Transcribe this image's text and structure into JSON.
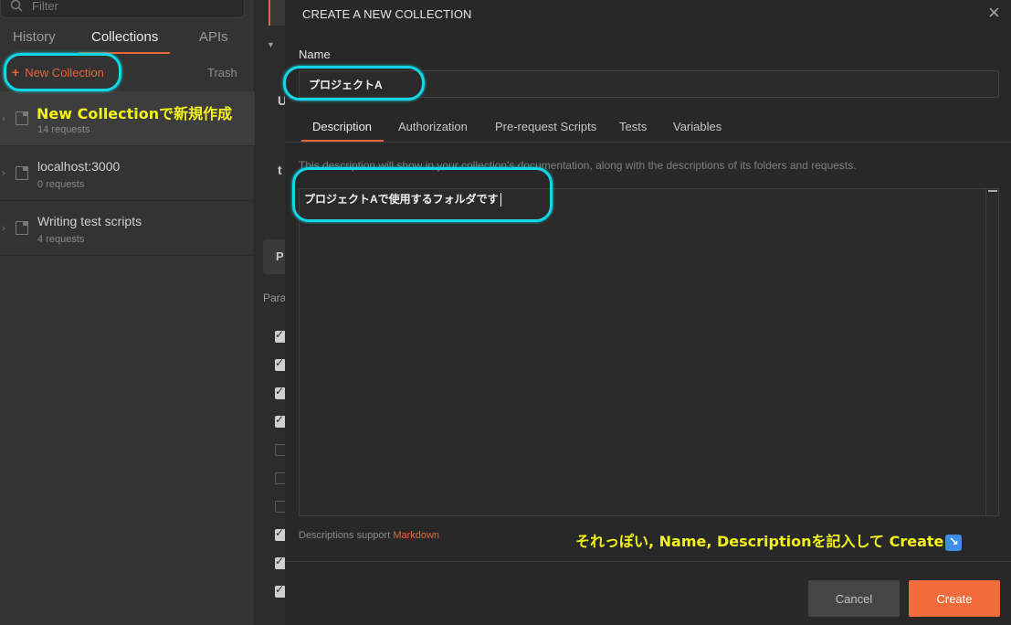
{
  "sidebar": {
    "filter_placeholder": "Filter",
    "tabs": [
      {
        "label": "History"
      },
      {
        "label": "Collections"
      },
      {
        "label": "APIs"
      }
    ],
    "new_collection": "New Collection",
    "trash": "Trash",
    "collections": [
      {
        "name": "",
        "count": "14 requests"
      },
      {
        "name": "localhost:3000",
        "count": "0 requests"
      },
      {
        "name": "Writing test scripts",
        "count": "4 requests"
      }
    ]
  },
  "middle": {
    "letter_u": "U",
    "letter_t": "t",
    "letter_p": "P",
    "para_label": "Para"
  },
  "modal": {
    "title": "CREATE A NEW COLLECTION",
    "close": "×",
    "name_label": "Name",
    "name_value": "プロジェクトA",
    "tabs": [
      {
        "label": "Description"
      },
      {
        "label": "Authorization"
      },
      {
        "label": "Pre-request Scripts"
      },
      {
        "label": "Tests"
      },
      {
        "label": "Variables"
      }
    ],
    "helper_text": "This description will show in your collection's documentation, along with the descriptions of its folders and requests.",
    "description_value": "プロジェクトAで使用するフォルダです",
    "markdown_prefix": "Descriptions support",
    "markdown_link": "Markdown",
    "cancel": "Cancel",
    "create": "Create"
  },
  "annotations": {
    "new_collection_note": "New Collectionで新規作成",
    "bottom_note": "それっぽい, Name, Descriptionを記入して Create",
    "bottom_icon": "↘"
  },
  "colors": {
    "accent": "#e3663a",
    "highlight": "#12d7e6",
    "annotation": "#f3f31a"
  }
}
